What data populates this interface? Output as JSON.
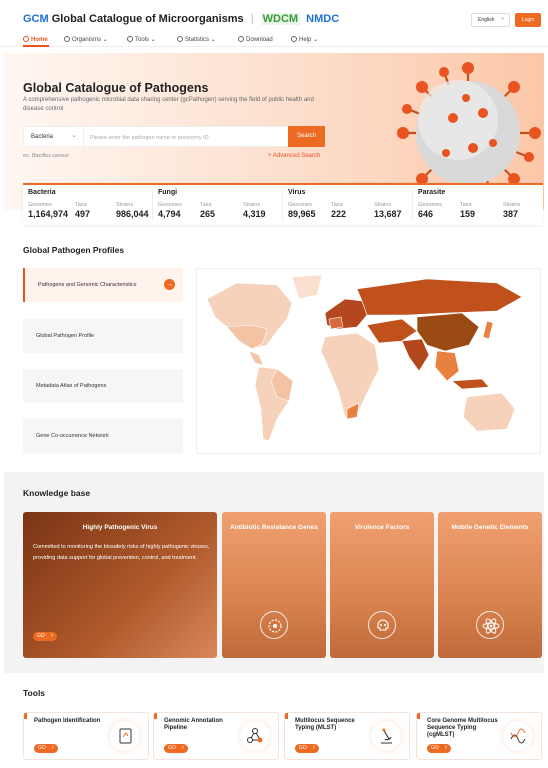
{
  "header": {
    "logo_prefix": "GCM",
    "logo_title": "Global Catalogue of Microorganisms",
    "logo_sep": "|",
    "logo_wdcm": "WDCM",
    "logo_nmdc": "NMDC",
    "language": "English",
    "login": "Login"
  },
  "nav": [
    {
      "label": "Home",
      "icon": "home-icon",
      "active": true
    },
    {
      "label": "Organisms",
      "icon": "organisms-icon",
      "active": false
    },
    {
      "label": "Tools",
      "icon": "tools-icon",
      "active": false
    },
    {
      "label": "Statistics",
      "icon": "statistics-icon",
      "active": false
    },
    {
      "label": "Download",
      "icon": "download-icon",
      "active": false
    },
    {
      "label": "Help",
      "icon": "help-icon",
      "active": false
    }
  ],
  "hero": {
    "title": "Global Catalogue of Pathogens",
    "description": "A comprehensive pathogenic microbial data sharing center (gcPathogen) serving the field of public health and disease control",
    "search_category": "Bacteria",
    "search_placeholder": "Please enter the pathogen name or taxonomy ID",
    "search_button": "Search",
    "example_prefix": "ex.",
    "example_value": "Bacillus cereus",
    "advanced_search": "+ Advanced Search"
  },
  "stats": [
    {
      "name": "Bacteria",
      "genomes_label": "Genomes",
      "genomes": "1,164,974",
      "taxa_label": "Taxa",
      "taxa": "497",
      "strains_label": "Strains",
      "strains": "986,044"
    },
    {
      "name": "Fungi",
      "genomes_label": "Genomes",
      "genomes": "4,794",
      "taxa_label": "Taxa",
      "taxa": "265",
      "strains_label": "Strains",
      "strains": "4,319"
    },
    {
      "name": "Virus",
      "genomes_label": "Genomes",
      "genomes": "89,965",
      "taxa_label": "Taxa",
      "taxa": "222",
      "strains_label": "Strains",
      "strains": "13,687"
    },
    {
      "name": "Parasite",
      "genomes_label": "Genomes",
      "genomes": "646",
      "taxa_label": "Taxa",
      "taxa": "159",
      "strains_label": "Strains",
      "strains": "387"
    }
  ],
  "profiles": {
    "title": "Global Pathogen Profiles",
    "items": [
      {
        "label": "Pathogens and Genomic Characteristics",
        "active": true
      },
      {
        "label": "Global Pathogen Profile",
        "active": false
      },
      {
        "label": "Metadata Atlas of Pathogens",
        "active": false
      },
      {
        "label": "Gene Co-occurrence Network",
        "active": false
      }
    ]
  },
  "knowledge": {
    "title": "Knowledge base",
    "go": "GO",
    "main": {
      "title": "Highly Pathogenic Virus",
      "description": "Committed to monitoring the biosafety risks of highly pathogenic viruses, providing data support for global prevention, control, and treatment."
    },
    "cards": [
      {
        "title": "Antibiotic Resistance Genes",
        "icon": "gear-cell-icon"
      },
      {
        "title": "Virulence Factors",
        "icon": "skull-icon"
      },
      {
        "title": "Mobile Genetic Elements",
        "icon": "atom-icon"
      }
    ]
  },
  "tools": {
    "title": "Tools",
    "go": "GO",
    "items": [
      {
        "title": "Pathogen Identification",
        "icon": "clipboard-icon"
      },
      {
        "title": "Genomic Annotation Pipeline",
        "icon": "network-icon"
      },
      {
        "title": "Multilocus Sequence Typing (MLST)",
        "icon": "microscope-icon"
      },
      {
        "title": "Core Genome Multilocus Sequence Typing (cgMLST)",
        "icon": "dna-icon"
      }
    ]
  },
  "colors": {
    "accent": "#ed6a23",
    "brand_blue": "#1e6fd9",
    "wdcm_green": "#3a9a3a"
  }
}
